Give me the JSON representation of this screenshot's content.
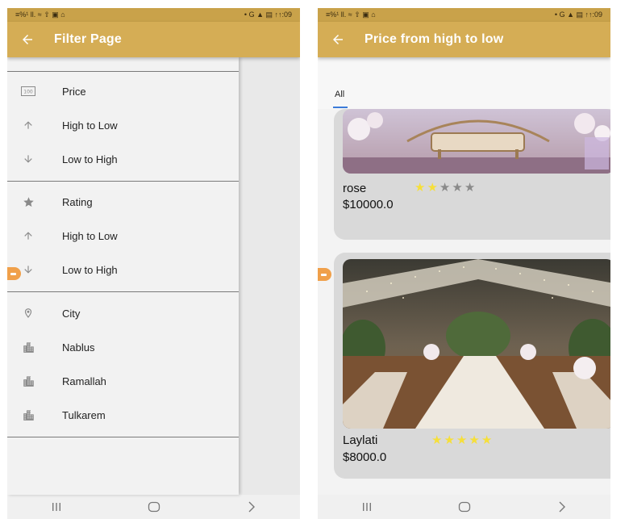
{
  "left_screen": {
    "status": {
      "left": "≡%¹ ll. ≈ ⇧ ▣ ⌂",
      "right": "• G ▲ ▤ ↑↑:09"
    },
    "appbar": {
      "title": "Filter Page"
    },
    "price_section": {
      "header": "Price",
      "items": [
        "High to Low",
        "Low to High"
      ]
    },
    "rating_section": {
      "header": "Rating",
      "items": [
        "High to Low",
        "Low to High"
      ]
    },
    "city_section": {
      "header": "City",
      "items": [
        "Nablus",
        "Ramallah",
        "Tulkarem"
      ]
    },
    "icons": {
      "back": "arrow-left-icon",
      "price": "price-tag-icon",
      "up": "arrow-up-icon",
      "down": "arrow-down-icon",
      "rating": "star-icon",
      "city": "location-pin-icon",
      "building": "city-building-icon"
    }
  },
  "right_screen": {
    "status": {
      "left": "≡%¹ ll. ≈ ⇧ ▣ ⌂",
      "right": "• G ▲ ▤ ↑↑:09"
    },
    "appbar": {
      "title": "Price from high to low"
    },
    "tabs": [
      "All"
    ],
    "cards": [
      {
        "name": "rose",
        "price": "$10000.0",
        "rating": 2,
        "max_rating": 5
      },
      {
        "name": "Laylati",
        "price": "$8000.0",
        "rating": 5,
        "max_rating": 5
      }
    ]
  },
  "colors": {
    "appbar": "#d5ad55",
    "statusbar": "#c9a24a",
    "star_filled": "#f6df3a",
    "star_empty": "#8a8a8a",
    "tab_indicator": "#3b7bd9",
    "card_bg": "#d9d9d9"
  }
}
